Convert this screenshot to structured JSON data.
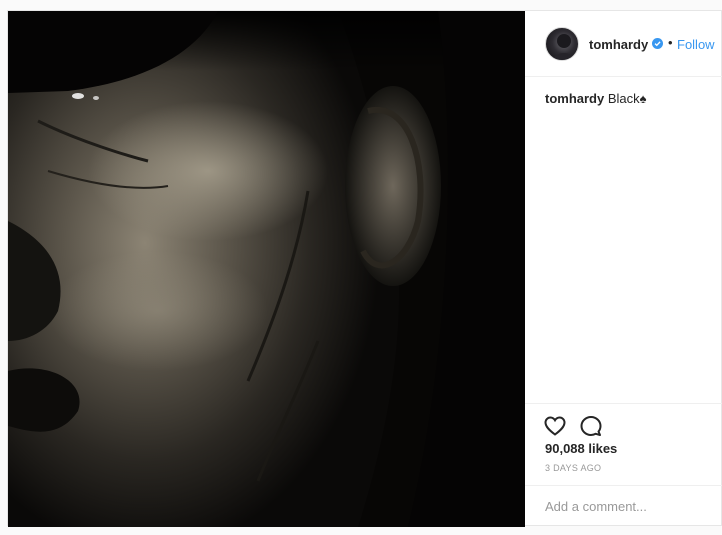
{
  "post": {
    "username": "tomhardy",
    "follow_label": "Follow",
    "dot": "•",
    "caption_user": "tomhardy",
    "caption_text": "Black♠",
    "likes": "90,088 likes",
    "timestamp": "3 DAYS AGO",
    "comment_placeholder": "Add a comment...",
    "icons": {
      "verified": "verified-badge-icon",
      "like": "heart-icon",
      "comment": "comment-bubble-icon"
    }
  },
  "colors": {
    "link": "#3897f0",
    "text": "#262626",
    "muted": "#999999",
    "divider": "#efefef"
  }
}
